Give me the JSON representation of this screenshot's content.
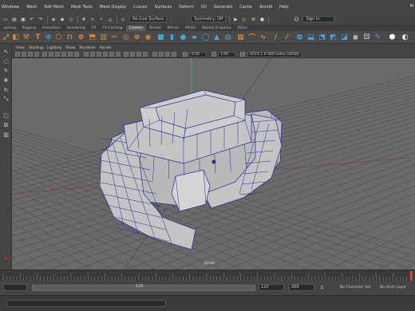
{
  "window": {
    "title_partial": "M"
  },
  "menubar": {
    "items": [
      "Windows",
      "Mesh",
      "Edit Mesh",
      "Mesh Tools",
      "Mesh Display",
      "Curves",
      "Surfaces",
      "Deform",
      "UV",
      "Generate",
      "Cache",
      "Arnold",
      "Help"
    ]
  },
  "statusline": {
    "live_surface": "No Live Surface",
    "symmetry": "Symmetry: Off",
    "sign_in": "Sign In"
  },
  "shelf": {
    "tabs": [
      "ulpting",
      "Rigging",
      "Animation",
      "Rendering",
      "FX",
      "FX Caching",
      "Custom",
      "Arnold",
      "Bifrost",
      "MASH",
      "Motion Graphics",
      "XGen"
    ],
    "active_tab": "Custom"
  },
  "viewport": {
    "menus": [
      "View",
      "Shading",
      "Lighting",
      "Show",
      "Renderer",
      "Panels"
    ],
    "near_value": "0.00",
    "far_value": "1.00",
    "color_space": "ACES 1.0 SDR-video (sRGB)",
    "camera_label": "persp"
  },
  "timeline": {
    "current_frame": "120",
    "range_start_field": "120",
    "range_end_field": "200",
    "character_set": "No Character Set",
    "anim_layer": "No Anim Layer"
  },
  "colors": {
    "grid_bg": "#6a6a6a",
    "wireframe": "#2a2a9a",
    "mesh_fill": "#c4c4c4",
    "shelf_orange": "#e8872a",
    "shelf_blue": "#3fa6d6"
  }
}
